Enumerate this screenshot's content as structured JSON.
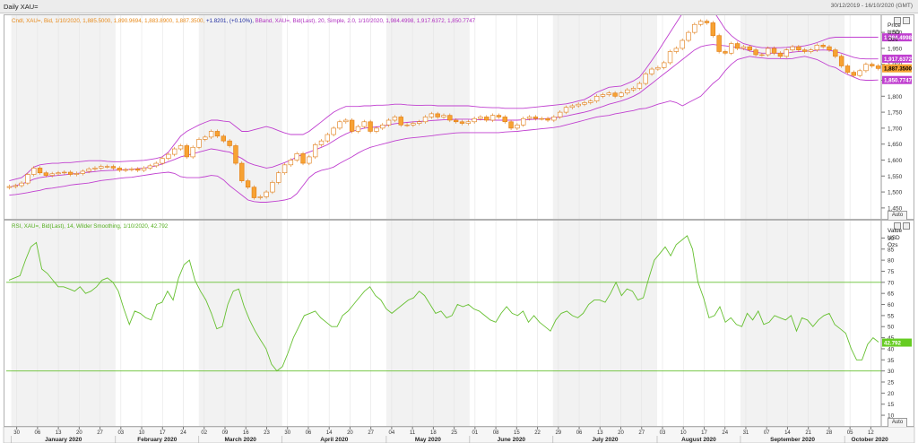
{
  "window": {
    "title": "Daily XAU=",
    "date_range": "30/12/2019 - 16/10/2020 (GMT)"
  },
  "price_panel": {
    "legend": {
      "candle": "Cndl, XAU=, Bid, 1/10/2020, 1,885.5000, 1,890.9694, 1,883.8900, 1,887.3500,",
      "change": "+1.8201, (+0.10%),",
      "bband": "BBand, XAU=, Bid(Last), 20, Simple, 2.0, 1/10/2020, 1,984.4998, 1,917.6372, 1,850.7747"
    },
    "axis_header": [
      "Price",
      "USD",
      "Ozs"
    ],
    "y_ticks": [
      "2,000",
      "1,950",
      "1,900",
      "1,850",
      "1,800",
      "1,750",
      "1,700",
      "1,650",
      "1,600",
      "1,550",
      "1,500",
      "1,450"
    ],
    "tags": {
      "upper": "1,984.4998",
      "middle": "1,917.6372",
      "last": "1,887.3500",
      "lower": "1,850.7747"
    },
    "auto_label": "Auto"
  },
  "rsi_panel": {
    "legend": "RSI, XAU=, Bid(Last), 14, Wilder Smoothing, 1/10/2020, 42.792",
    "axis_header": [
      "Value",
      "USD",
      "Ozs"
    ],
    "y_ticks": [
      "90",
      "85",
      "80",
      "75",
      "70",
      "65",
      "60",
      "55",
      "50",
      "45",
      "40",
      "35",
      "30",
      "25",
      "20",
      "15",
      "10"
    ],
    "tag": "42.792",
    "auto_label": "Auto"
  },
  "x_axis": {
    "day_ticks": [
      "30",
      "06",
      "13",
      "20",
      "27",
      "03",
      "10",
      "17",
      "24",
      "02",
      "09",
      "16",
      "23",
      "30",
      "06",
      "14",
      "20",
      "27",
      "04",
      "11",
      "18",
      "25",
      "01",
      "08",
      "15",
      "22",
      "29",
      "06",
      "13",
      "20",
      "27",
      "03",
      "10",
      "17",
      "24",
      "31",
      "07",
      "14",
      "21",
      "28",
      "05",
      "12"
    ],
    "months": [
      "January 2020",
      "February 2020",
      "March 2020",
      "April 2020",
      "May 2020",
      "June 2020",
      "July 2020",
      "August 2020",
      "September 2020",
      "October 2020"
    ]
  },
  "chart_data": [
    {
      "type": "candlestick",
      "title": "Daily XAU=",
      "ylabel": "Price USD Ozs",
      "ylim": [
        1430,
        2020
      ],
      "series": [
        {
          "name": "Cndl, XAU=, Bid",
          "values": [
            1517,
            1520,
            1528,
            1555,
            1575,
            1560,
            1552,
            1557,
            1560,
            1562,
            1555,
            1558,
            1565,
            1572,
            1575,
            1580,
            1580,
            1575,
            1568,
            1570,
            1572,
            1568,
            1575,
            1582,
            1590,
            1605,
            1618,
            1635,
            1645,
            1610,
            1640,
            1665,
            1672,
            1690,
            1675,
            1660,
            1645,
            1590,
            1535,
            1515,
            1482,
            1485,
            1500,
            1530,
            1560,
            1585,
            1600,
            1620,
            1590,
            1610,
            1648,
            1660,
            1680,
            1700,
            1720,
            1725,
            1690,
            1705,
            1720,
            1690,
            1700,
            1710,
            1725,
            1735,
            1710,
            1710,
            1715,
            1720,
            1735,
            1745,
            1735,
            1740,
            1725,
            1720,
            1715,
            1720,
            1730,
            1735,
            1725,
            1740,
            1735,
            1720,
            1700,
            1710,
            1730,
            1735,
            1730,
            1730,
            1725,
            1735,
            1750,
            1765,
            1770,
            1775,
            1780,
            1785,
            1800,
            1805,
            1810,
            1800,
            1810,
            1820,
            1825,
            1840,
            1870,
            1885,
            1890,
            1905,
            1940,
            1950,
            1975,
            2000,
            2025,
            2035,
            2030,
            1990,
            1940,
            1935,
            1965,
            1950,
            1955,
            1945,
            1930,
            1930,
            1950,
            1935,
            1925,
            1945,
            1955,
            1945,
            1940,
            1945,
            1960,
            1955,
            1945,
            1925,
            1895,
            1875,
            1865,
            1880,
            1900,
            1895,
            1887
          ]
        },
        {
          "name": "BBand upper",
          "values": [
            1535,
            1540,
            1545,
            1560,
            1578,
            1585,
            1588,
            1590,
            1590,
            1592,
            1592,
            1594,
            1596,
            1598,
            1598,
            1598,
            1596,
            1595,
            1595,
            1596,
            1597,
            1598,
            1599,
            1602,
            1605,
            1610,
            1625,
            1650,
            1675,
            1690,
            1700,
            1710,
            1718,
            1725,
            1725,
            1722,
            1720,
            1705,
            1690,
            1690,
            1695,
            1700,
            1705,
            1700,
            1692,
            1685,
            1680,
            1680,
            1680,
            1690,
            1705,
            1720,
            1735,
            1750,
            1760,
            1768,
            1768,
            1768,
            1770,
            1770,
            1772,
            1772,
            1773,
            1775,
            1775,
            1773,
            1772,
            1771,
            1772,
            1772,
            1770,
            1770,
            1770,
            1770,
            1770,
            1770,
            1768,
            1766,
            1765,
            1764,
            1764,
            1762,
            1762,
            1762,
            1762,
            1764,
            1766,
            1768,
            1770,
            1772,
            1774,
            1776,
            1780,
            1785,
            1790,
            1800,
            1812,
            1820,
            1828,
            1830,
            1832,
            1840,
            1848,
            1860,
            1885,
            1912,
            1940,
            1970,
            2000,
            2030,
            2060,
            2080,
            2100,
            2110,
            2090,
            2070,
            2040,
            2010,
            1990,
            1975,
            1965,
            1960,
            1955,
            1952,
            1952,
            1952,
            1952,
            1953,
            1955,
            1955,
            1958,
            1962,
            1968,
            1975,
            1982,
            1985,
            1985,
            1985,
            1985,
            1985,
            1985,
            1985,
            1985
          ]
        },
        {
          "name": "BBand middle",
          "values": [
            1515,
            1520,
            1525,
            1532,
            1540,
            1545,
            1548,
            1550,
            1552,
            1554,
            1556,
            1558,
            1560,
            1562,
            1564,
            1566,
            1567,
            1568,
            1569,
            1570,
            1571,
            1573,
            1575,
            1578,
            1582,
            1588,
            1595,
            1602,
            1610,
            1615,
            1620,
            1625,
            1630,
            1635,
            1632,
            1628,
            1625,
            1615,
            1605,
            1592,
            1585,
            1580,
            1575,
            1578,
            1585,
            1592,
            1600,
            1610,
            1618,
            1625,
            1632,
            1640,
            1648,
            1660,
            1672,
            1682,
            1690,
            1695,
            1700,
            1702,
            1704,
            1706,
            1710,
            1714,
            1716,
            1718,
            1720,
            1721,
            1722,
            1724,
            1725,
            1726,
            1727,
            1728,
            1728,
            1728,
            1727,
            1726,
            1726,
            1725,
            1725,
            1725,
            1725,
            1725,
            1726,
            1727,
            1728,
            1729,
            1730,
            1732,
            1735,
            1738,
            1742,
            1746,
            1750,
            1755,
            1762,
            1768,
            1775,
            1780,
            1785,
            1792,
            1800,
            1810,
            1825,
            1840,
            1855,
            1870,
            1885,
            1900,
            1915,
            1930,
            1945,
            1955,
            1960,
            1962,
            1960,
            1958,
            1955,
            1952,
            1948,
            1942,
            1938,
            1935,
            1935,
            1935,
            1935,
            1935,
            1938,
            1940,
            1941,
            1942,
            1944,
            1945,
            1944,
            1940,
            1935,
            1928,
            1922,
            1918,
            1917,
            1917,
            1917
          ]
        },
        {
          "name": "BBand lower",
          "values": [
            1490,
            1492,
            1495,
            1498,
            1502,
            1505,
            1510,
            1512,
            1515,
            1518,
            1522,
            1524,
            1526,
            1528,
            1532,
            1536,
            1538,
            1540,
            1543,
            1545,
            1546,
            1549,
            1552,
            1555,
            1558,
            1560,
            1562,
            1558,
            1548,
            1545,
            1545,
            1545,
            1548,
            1552,
            1550,
            1538,
            1520,
            1505,
            1490,
            1475,
            1470,
            1468,
            1468,
            1470,
            1472,
            1475,
            1480,
            1495,
            1520,
            1545,
            1560,
            1568,
            1572,
            1578,
            1590,
            1600,
            1610,
            1622,
            1632,
            1640,
            1645,
            1650,
            1655,
            1660,
            1664,
            1668,
            1670,
            1672,
            1674,
            1676,
            1679,
            1681,
            1683,
            1685,
            1686,
            1686,
            1686,
            1686,
            1686,
            1686,
            1686,
            1688,
            1689,
            1690,
            1692,
            1694,
            1696,
            1698,
            1700,
            1702,
            1705,
            1710,
            1715,
            1720,
            1725,
            1730,
            1735,
            1738,
            1740,
            1745,
            1748,
            1752,
            1755,
            1760,
            1762,
            1768,
            1775,
            1780,
            1785,
            1780,
            1770,
            1780,
            1790,
            1800,
            1820,
            1840,
            1855,
            1880,
            1900,
            1915,
            1920,
            1925,
            1922,
            1920,
            1918,
            1918,
            1918,
            1917,
            1918,
            1922,
            1925,
            1920,
            1915,
            1905,
            1895,
            1890,
            1878,
            1868,
            1860,
            1852,
            1850,
            1850,
            1851
          ]
        }
      ]
    },
    {
      "type": "line",
      "title": "RSI, XAU=, Bid(Last), 14, Wilder Smoothing",
      "ylabel": "Value USD Ozs",
      "ylim": [
        8,
        93
      ],
      "hlines": [
        70,
        30
      ],
      "series": [
        {
          "name": "RSI",
          "values": [
            71,
            72,
            73,
            80,
            86,
            88,
            76,
            74,
            71,
            68,
            68,
            67,
            66,
            68,
            65,
            66,
            68,
            71,
            72,
            70,
            66,
            58,
            51,
            57,
            56,
            54,
            53,
            60,
            61,
            66,
            62,
            72,
            78,
            80,
            71,
            66,
            62,
            56,
            49,
            50,
            60,
            66,
            67,
            59,
            53,
            48,
            44,
            40,
            33,
            30,
            32,
            38,
            45,
            50,
            55,
            56,
            57,
            54,
            52,
            50,
            50,
            55,
            57,
            60,
            63,
            66,
            68,
            64,
            62,
            58,
            56,
            58,
            60,
            62,
            63,
            66,
            64,
            60,
            56,
            57,
            54,
            55,
            60,
            59,
            60,
            58,
            57,
            55,
            53,
            52,
            56,
            59,
            56,
            55,
            57,
            52,
            55,
            52,
            50,
            48,
            53,
            56,
            57,
            55,
            54,
            56,
            60,
            62,
            62,
            61,
            65,
            70,
            64,
            67,
            66,
            62,
            63,
            72,
            80,
            83,
            86,
            82,
            87,
            89,
            91,
            85,
            70,
            63,
            54,
            55,
            59,
            52,
            54,
            51,
            50,
            56,
            53,
            57,
            51,
            52,
            55,
            54,
            53,
            55,
            48,
            54,
            53,
            50,
            53,
            55,
            56,
            51,
            49,
            47,
            40,
            35,
            35,
            42,
            45,
            43
          ]
        }
      ]
    }
  ]
}
